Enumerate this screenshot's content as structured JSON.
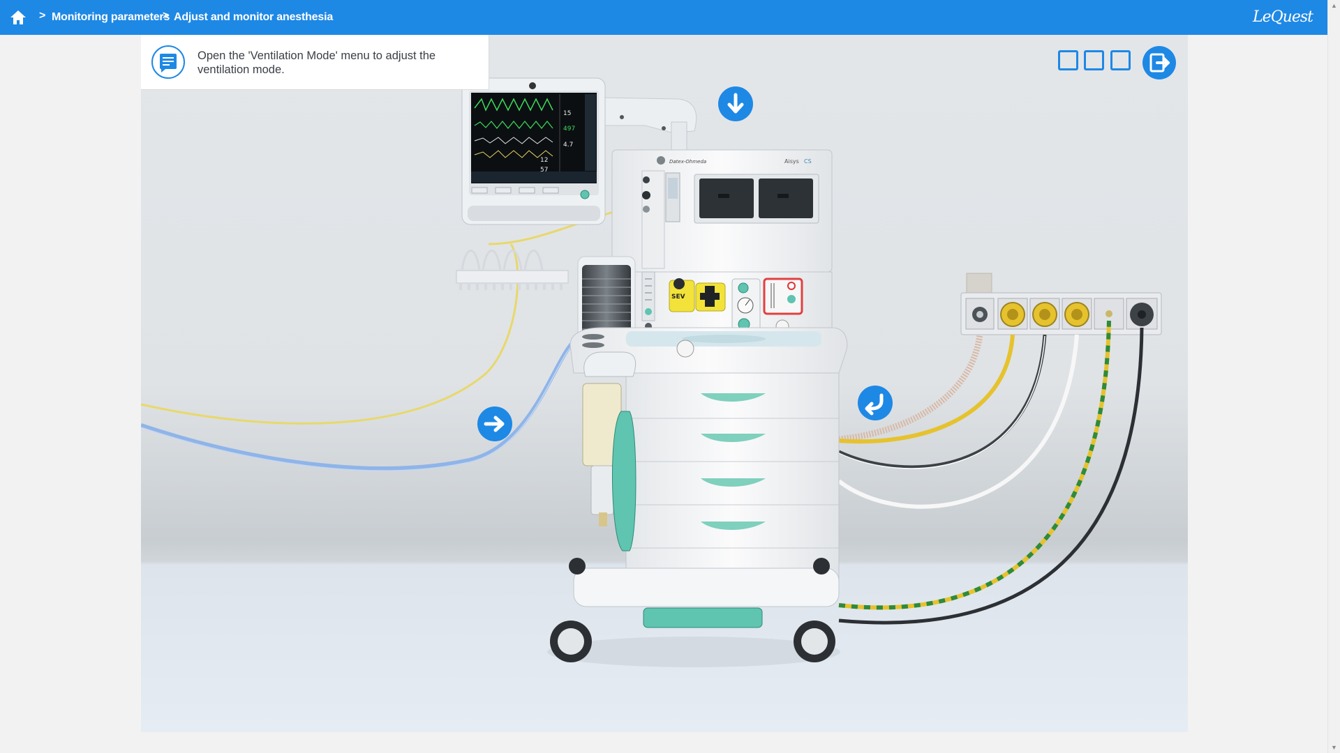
{
  "header": {
    "breadcrumb": [
      {
        "label": "Monitoring parameters"
      },
      {
        "label": "Adjust and monitor anesthesia"
      }
    ],
    "brand": "LeQuest"
  },
  "instruction": {
    "text": "Open the 'Ventilation Mode' menu to adjust the ventilation mode."
  },
  "machine": {
    "maker": "Datex-Ohmeda",
    "model": "Aisys",
    "model_suffix": "CS",
    "vaporizer_label": "SEV",
    "monitor_values": [
      "15",
      "497",
      "4.7",
      "12",
      "57"
    ]
  },
  "colors": {
    "accent": "#1e88e5",
    "tube_blue": "#8fb4e8",
    "cable_yellow": "#e6c22e",
    "teal": "#5fc4b0"
  }
}
